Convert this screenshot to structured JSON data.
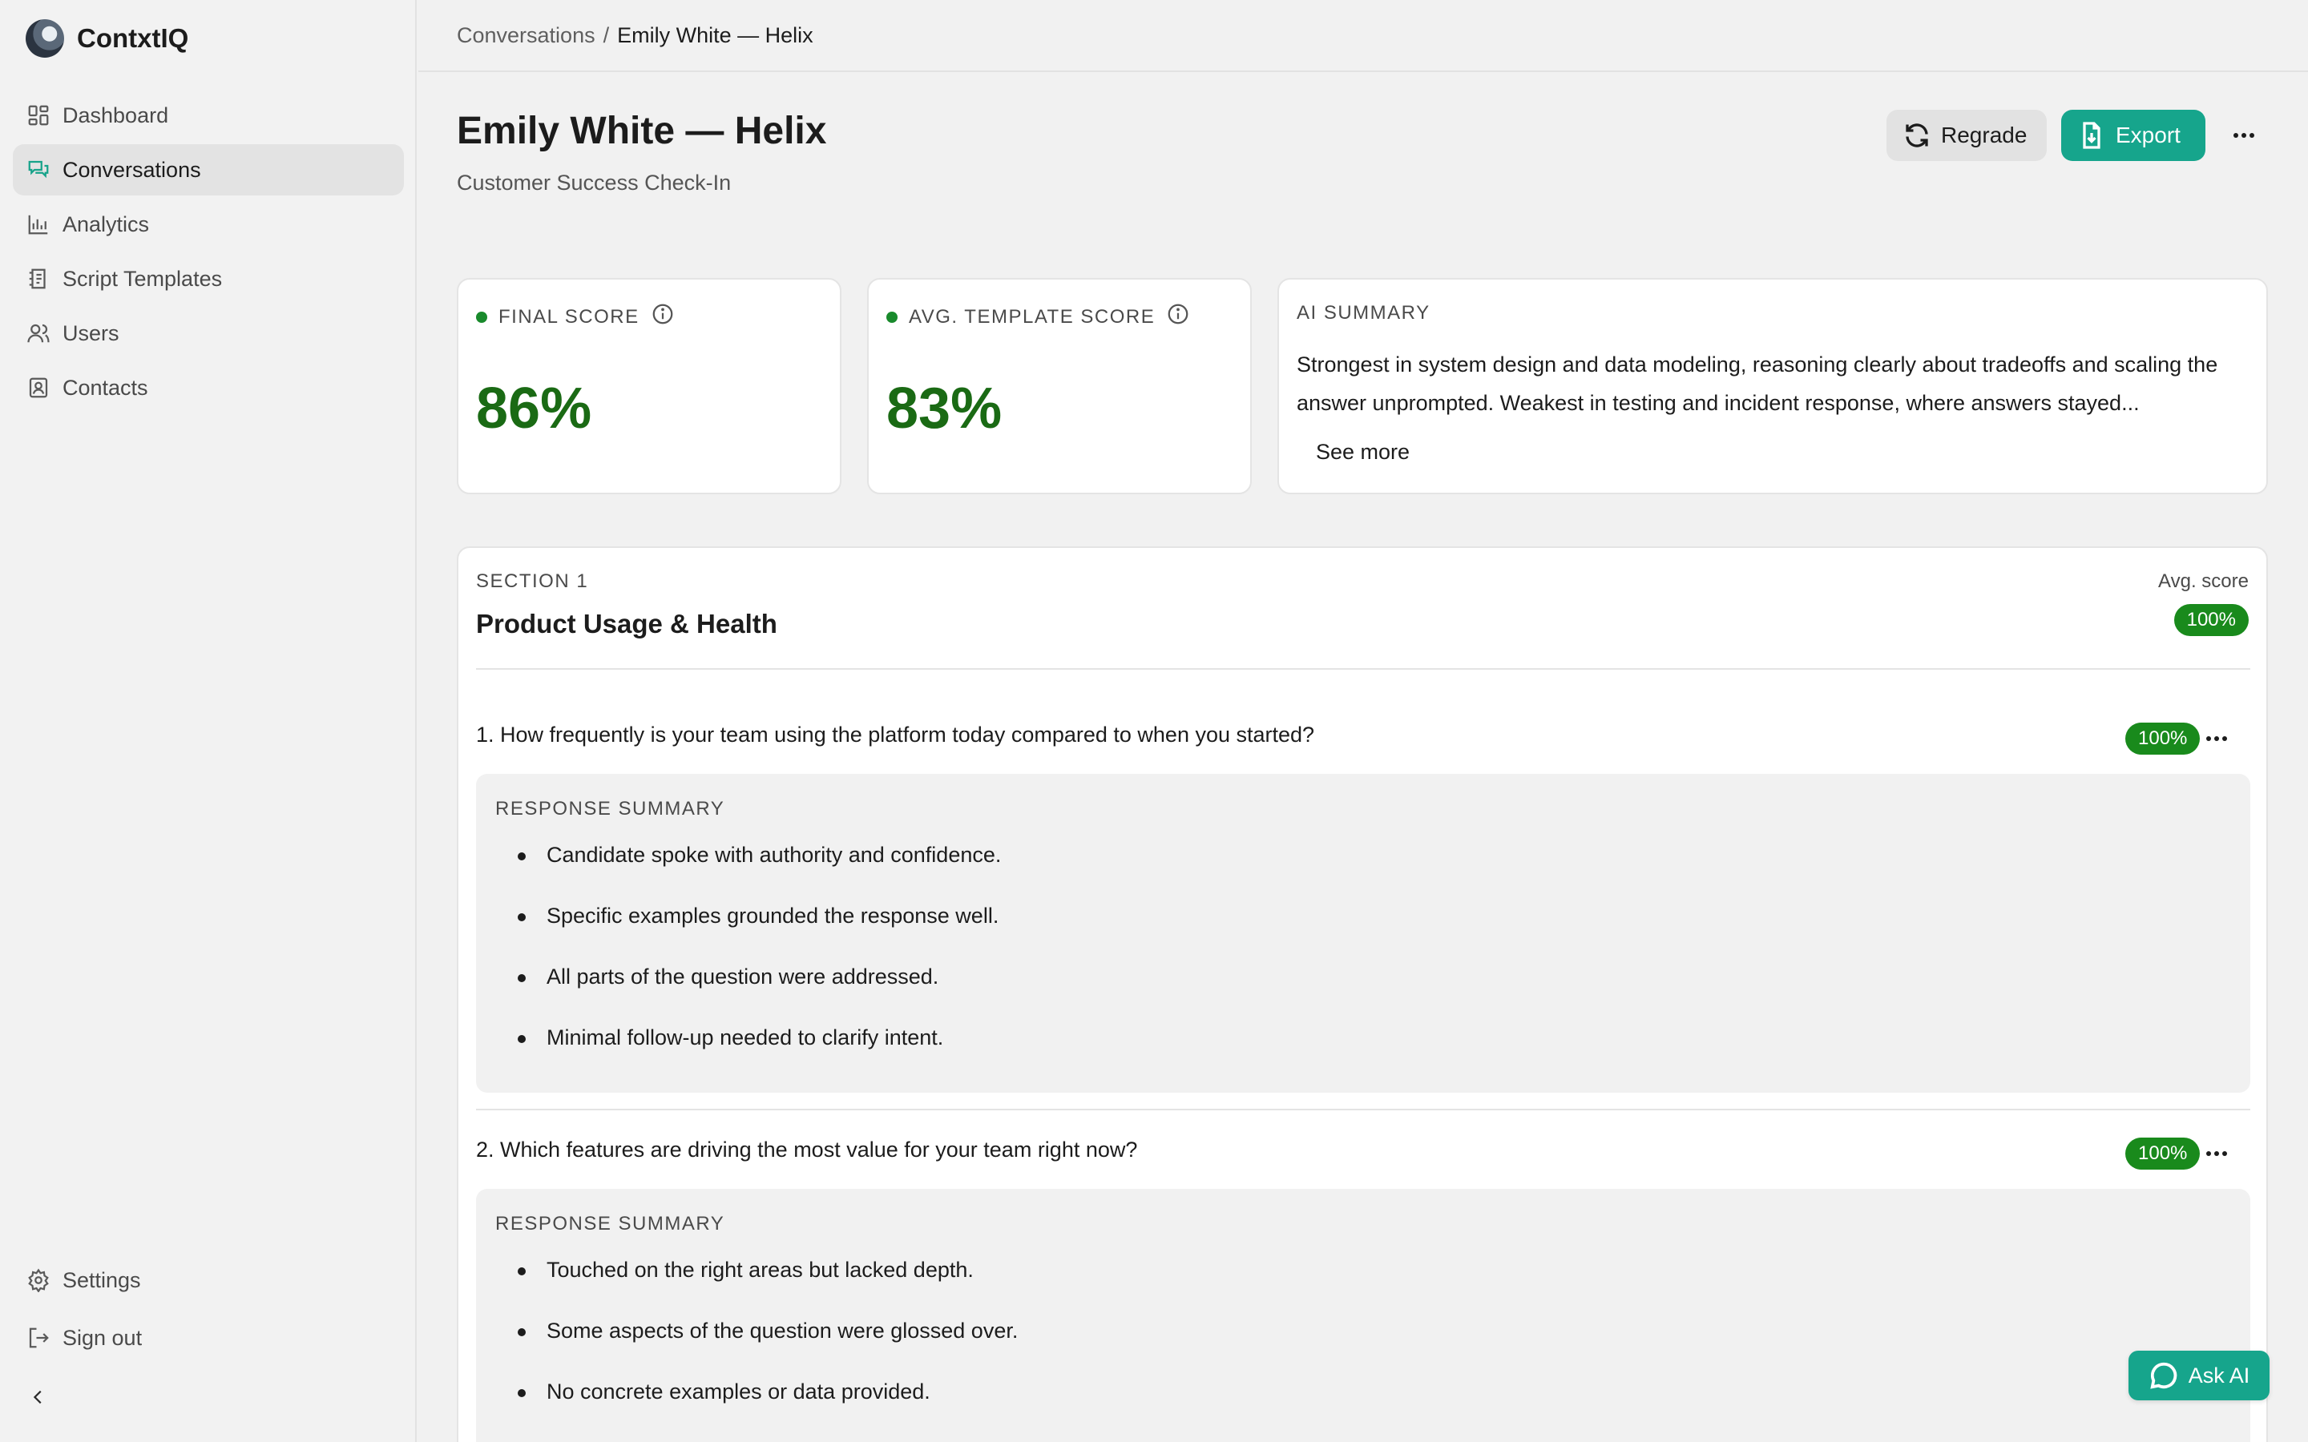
{
  "app": {
    "name": "ContxtIQ"
  },
  "sidebar": {
    "items": [
      {
        "label": "Dashboard",
        "icon": "dashboard-icon"
      },
      {
        "label": "Conversations",
        "icon": "conversations-icon",
        "active": true
      },
      {
        "label": "Analytics",
        "icon": "analytics-icon"
      },
      {
        "label": "Script Templates",
        "icon": "script-templates-icon"
      },
      {
        "label": "Users",
        "icon": "users-icon"
      },
      {
        "label": "Contacts",
        "icon": "contacts-icon"
      }
    ],
    "bottom": [
      {
        "label": "Settings",
        "icon": "gear-icon"
      },
      {
        "label": "Sign out",
        "icon": "sign-out-icon"
      }
    ],
    "collapse_icon": "chevron-left-icon"
  },
  "breadcrumb": {
    "parent": "Conversations",
    "separator": "/",
    "current": "Emily White — Helix"
  },
  "header": {
    "title": "Emily White — Helix",
    "subtitle": "Customer Success Check-In",
    "regrade_label": "Regrade",
    "export_label": "Export"
  },
  "scores": {
    "final": {
      "label": "FINAL SCORE",
      "value": "86%"
    },
    "avg_template": {
      "label": "AVG. TEMPLATE SCORE",
      "value": "83%"
    }
  },
  "ai_summary": {
    "label": "AI SUMMARY",
    "text": "Strongest in system design and data modeling, reasoning clearly about tradeoffs and scaling the answer unprompted. Weakest in testing and incident response, where answers stayed...",
    "see_more": "See more"
  },
  "section": {
    "eyebrow": "SECTION 1",
    "title": "Product Usage & Health",
    "avg_label": "Avg. score",
    "avg_score": "100%",
    "questions": [
      {
        "text": "1. How frequently is your team using the platform today compared to when you started?",
        "score": "100%",
        "response_label": "RESPONSE SUMMARY",
        "bullets": [
          "Candidate spoke with authority and confidence.",
          "Specific examples grounded the response well.",
          "All parts of the question were addressed.",
          "Minimal follow-up needed to clarify intent."
        ]
      },
      {
        "text": "2. Which features are driving the most value for your team right now?",
        "score": "100%",
        "response_label": "RESPONSE SUMMARY",
        "bullets": [
          "Touched on the right areas but lacked depth.",
          "Some aspects of the question were glossed over.",
          "No concrete examples or data provided."
        ]
      }
    ]
  },
  "ask_ai": {
    "label": "Ask AI"
  },
  "colors": {
    "accent": "#16a58c",
    "score_green": "#1a6a14",
    "pill_green": "#198a1c"
  }
}
